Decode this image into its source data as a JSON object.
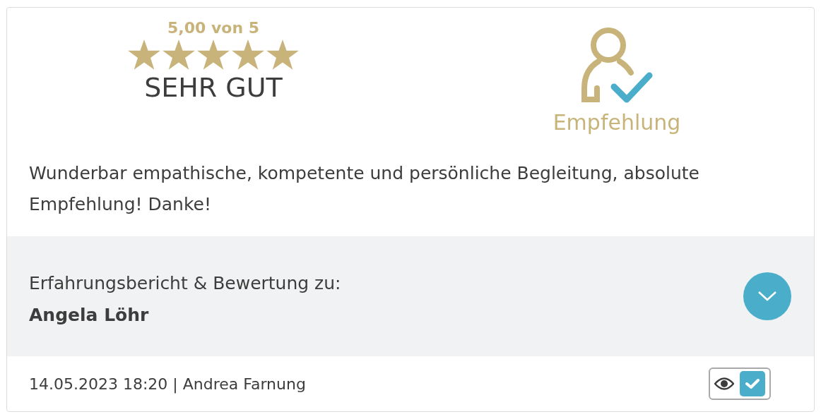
{
  "rating": {
    "score": "5,00 von 5",
    "stars": 5,
    "verdict": "SEHR GUT"
  },
  "recommendation": {
    "label": "Empfehlung"
  },
  "review_text": "Wunderbar empathische, kompetente und persönliche Begleitung, absolute Empfehlung! Danke!",
  "subject": {
    "caption": "Erfahrungsbericht & Bewertung zu:",
    "name": "Angela Löhr"
  },
  "footer": {
    "meta": "14.05.2023 18:20 | Andrea Farnung",
    "verified": true
  }
}
